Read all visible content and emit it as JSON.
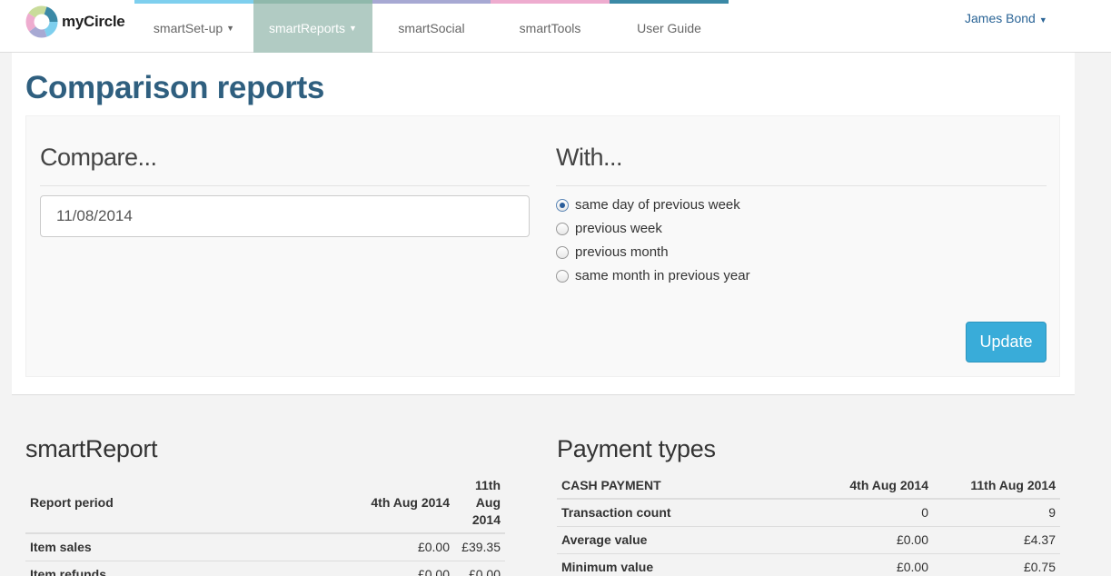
{
  "brand": {
    "name": "myCircle"
  },
  "nav": {
    "items": [
      {
        "label": "smartSet-up",
        "has_dropdown": true,
        "accent": "#7ecfee"
      },
      {
        "label": "smartReports",
        "has_dropdown": true,
        "accent": "#8fb8ab",
        "active": true
      },
      {
        "label": "smartSocial",
        "has_dropdown": false,
        "accent": "#a7a9d3"
      },
      {
        "label": "smartTools",
        "has_dropdown": false,
        "accent": "#eeaccf"
      },
      {
        "label": "User Guide",
        "has_dropdown": false,
        "accent": "#3b89a6"
      }
    ],
    "user": "James Bond"
  },
  "page": {
    "title": "Comparison reports"
  },
  "compare": {
    "heading": "Compare...",
    "date_value": "11/08/2014"
  },
  "with": {
    "heading": "With...",
    "options": [
      {
        "label": "same day of previous week",
        "checked": true
      },
      {
        "label": "previous week",
        "checked": false
      },
      {
        "label": "previous month",
        "checked": false
      },
      {
        "label": "same month in previous year",
        "checked": false
      }
    ],
    "update_label": "Update"
  },
  "smart_report": {
    "heading": "smartReport",
    "columns": [
      "Report period",
      "4th Aug 2014",
      "11th Aug 2014"
    ],
    "rows": [
      {
        "label": "Item sales",
        "a": "£0.00",
        "b": "£39.35"
      },
      {
        "label": "Item refunds",
        "a": "£0.00",
        "b": "£0.00"
      }
    ]
  },
  "payment_types": {
    "heading": "Payment types",
    "columns": [
      "CASH PAYMENT",
      "4th Aug 2014",
      "11th Aug 2014"
    ],
    "rows": [
      {
        "label": "Transaction count",
        "a": "0",
        "b": "9"
      },
      {
        "label": "Average value",
        "a": "£0.00",
        "b": "£4.37"
      },
      {
        "label": "Minimum value",
        "a": "£0.00",
        "b": "£0.75"
      }
    ]
  },
  "colors": {
    "title": "#2f5f7f",
    "active_tab": "#b1cbc3",
    "button": "#39acd9",
    "link": "#2a6496"
  }
}
